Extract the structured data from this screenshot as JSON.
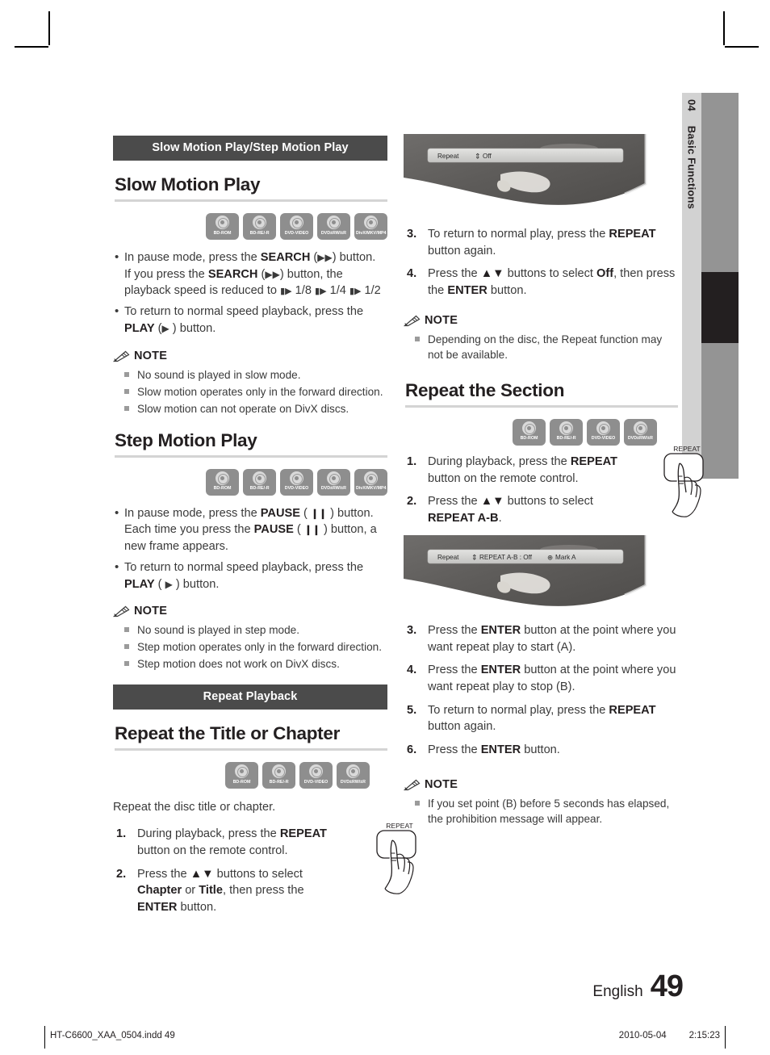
{
  "page": {
    "chapter_number": "04",
    "chapter_title": "Basic Functions",
    "language": "English",
    "page_number": "49",
    "print_file": "HT-C6600_XAA_0504.indd   49",
    "print_date": "2010-05-04",
    "print_time": "2:15:23"
  },
  "left_column": {
    "banner": "Slow Motion Play/Step Motion Play",
    "slow_motion": {
      "heading": "Slow Motion Play",
      "discs": [
        "BD-ROM",
        "BD-RE/-R",
        "DVD-VIDEO",
        "DVD±RW/±R",
        "DivX/MKV/MP4"
      ],
      "bullets": [
        "In pause mode, press the SEARCH (▶▶) button.\nIf you press the SEARCH (▶▶) button, the playback speed is reduced to ▮▶ 1/8 ▮▶ 1/4 ▮▶ 1/2",
        "To return to normal speed playback, press the PLAY (▶ ) button."
      ],
      "note_label": "NOTE",
      "notes": [
        "No sound is played in slow mode.",
        "Slow motion operates only in the forward direction.",
        "Slow motion can not operate on DivX discs."
      ]
    },
    "step_motion": {
      "heading": "Step Motion Play",
      "discs": [
        "BD-ROM",
        "BD-RE/-R",
        "DVD-VIDEO",
        "DVD±RW/±R",
        "DivX/MKV/MP4"
      ],
      "bullets": [
        "In pause mode, press the PAUSE ( ❙❙ ) button. Each time you press the PAUSE ( ❙❙ ) button, a new frame appears.",
        "To return to normal speed playback, press the PLAY ( ▶ ) button."
      ],
      "note_label": "NOTE",
      "notes": [
        "No sound is played in step mode.",
        "Step motion operates only in the forward direction.",
        "Step motion does not work on DivX discs."
      ]
    },
    "repeat_banner": "Repeat Playback",
    "repeat_title_chapter": {
      "heading": "Repeat the Title or Chapter",
      "discs": [
        "BD-ROM",
        "BD-RE/-R",
        "DVD-VIDEO",
        "DVD±RW/±R"
      ],
      "intro": "Repeat the disc title or chapter.",
      "steps": [
        {
          "num": "1.",
          "text": "During playback, press the REPEAT button on the remote control."
        },
        {
          "num": "2.",
          "text": "Press the ▲▼ buttons to select Chapter or Title, then press the ENTER button."
        }
      ],
      "remote_label": "REPEAT"
    }
  },
  "right_column": {
    "osd_top": {
      "label": "Repeat",
      "arrows": "⇕",
      "value": "Off"
    },
    "steps_top": [
      {
        "num": "3.",
        "text": "To return to normal play, press the REPEAT button again."
      },
      {
        "num": "4.",
        "text": "Press the ▲▼ buttons to select Off, then press the ENTER button."
      }
    ],
    "note_top": {
      "label": "NOTE",
      "items": [
        "Depending on the disc, the Repeat function may not be available."
      ]
    },
    "repeat_section": {
      "heading": "Repeat the Section",
      "discs": [
        "BD-ROM",
        "BD-RE/-R",
        "DVD-VIDEO",
        "DVD±RW/±R"
      ],
      "steps_first": [
        {
          "num": "1.",
          "text": "During playback, press the REPEAT button on the remote control."
        },
        {
          "num": "2.",
          "text": "Press the ▲▼ buttons to select REPEAT A-B."
        }
      ],
      "remote_label": "REPEAT",
      "osd": {
        "label": "Repeat",
        "arrows": "⇕",
        "value": "REPEAT A-B : Off",
        "mark": "Mark A"
      },
      "steps_rest": [
        {
          "num": "3.",
          "text": "Press the ENTER button at the point where you want repeat play to start (A)."
        },
        {
          "num": "4.",
          "text": "Press the ENTER button at the point where you want repeat play to stop (B)."
        },
        {
          "num": "5.",
          "text": "To return to normal play, press the REPEAT button again."
        },
        {
          "num": "6.",
          "text": "Press the ENTER button."
        }
      ],
      "note": {
        "label": "NOTE",
        "items": [
          "If you set point (B) before 5 seconds has elapsed, the prohibition message will appear."
        ]
      }
    }
  },
  "colors": {
    "banner_bg": "#4b4b4b",
    "rule": "#d4d4d4",
    "disc_badge": "#8e8e8e",
    "tab_light": "#d2d2d2",
    "tab_dark": "#949494",
    "tab_black": "#231f20"
  }
}
